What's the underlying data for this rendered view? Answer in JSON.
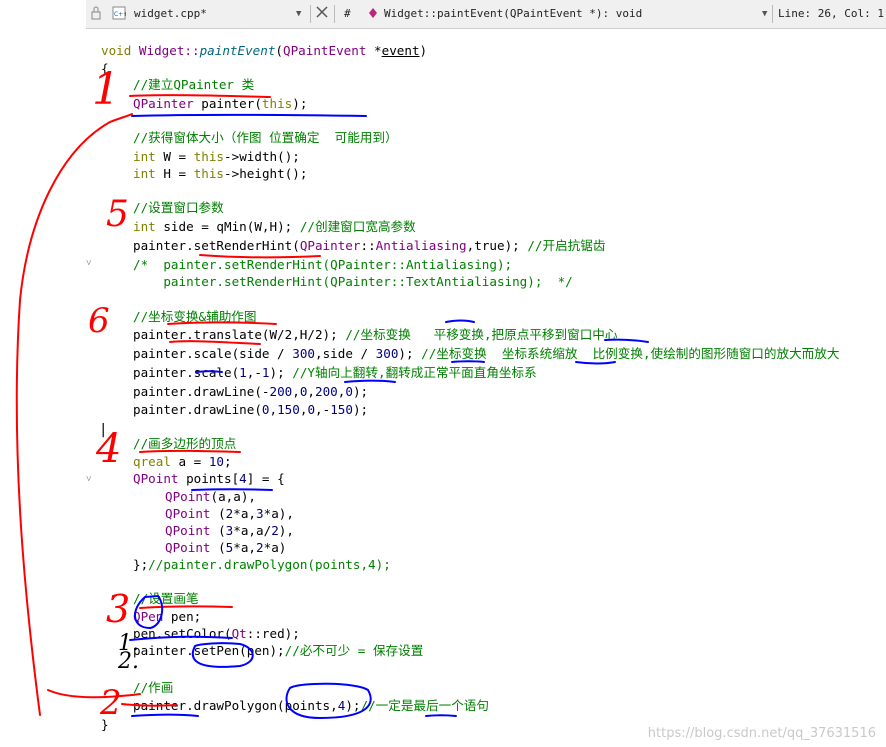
{
  "toolbar": {
    "filename": "widget.cpp*",
    "hash": "#",
    "function": "Widget::paintEvent(QPaintEvent *): void",
    "position": "Line: 26, Col: 1"
  },
  "code": {
    "l1": {
      "a": "void ",
      "b": "Widget::",
      "c": "paintEvent",
      "d": "(",
      "e": "QPaintEvent ",
      "f": "*",
      "g": "event",
      ")": ")"
    },
    "l2": "{",
    "l3": "//建立QPainter 类",
    "l4": {
      "a": "QPainter ",
      "b": "painter(",
      "c": "this",
      "d": ");"
    },
    "l5": "//获得窗体大小（作图 位置确定  可能用到）",
    "l6": {
      "a": "int ",
      "b": "W = ",
      "c": "this",
      "d": "->width();"
    },
    "l7": {
      "a": "int ",
      "b": "H = ",
      "c": "this",
      "d": "->height();"
    },
    "l8": "//设置窗口参数",
    "l9": {
      "a": "int ",
      "b": "side = qMin(W,H); ",
      "c": "//创建窗口宽高参数"
    },
    "l10": {
      "a": "painter.setRenderHint(",
      "b": "QPainter",
      "c": "::",
      "d": "Antialiasing",
      "e": ",true); ",
      "f": "//开启抗锯齿"
    },
    "l11": "/*  painter.setRenderHint(QPainter::Antialiasing);",
    "l12": "    painter.setRenderHint(QPainter::TextAntialiasing);  */",
    "l13": "//坐标变换&辅助作图",
    "l14": {
      "a": "painter.translate(W/2,H/2); ",
      "b": "//坐标变换   平移变换,把原点平移到窗口中心"
    },
    "l15": {
      "a": "painter.scale(side / ",
      "n1": "300",
      "b": ",side / ",
      "n2": "300",
      "c": "); ",
      "d": "//坐标变换  坐标系统缩放  比例变换,使绘制的图形随窗口的放大而放大"
    },
    "l16": {
      "a": "painter.scale(",
      "n1": "1",
      "b": ",-",
      "n2": "1",
      "c": "); ",
      "d": "//Y轴向上翻转,翻转成正常平面直角坐标系"
    },
    "l17": {
      "a": "painter.drawLine(-",
      "n1": "200",
      "b": ",",
      "n2": "0",
      "c": ",",
      "n3": "200",
      "d": ",",
      "n4": "0",
      "e": ");"
    },
    "l18": {
      "a": "painter.drawLine(",
      "n1": "0",
      "b": ",",
      "n2": "150",
      "c": ",",
      "n3": "0",
      "d": ",-",
      "n4": "150",
      "e": ");"
    },
    "l19": "//画多边形的顶点",
    "l20": {
      "a": "qreal ",
      "b": "a = ",
      "n1": "10",
      "c": ";"
    },
    "l21": {
      "a": "QPoint ",
      "b": "points[",
      "n1": "4",
      "c": "] = {"
    },
    "l22": {
      "a": "QPoint",
      "b": "(a,a),"
    },
    "l23": {
      "a": "QPoint",
      "b": " (",
      "n1": "2",
      "c": "*a,",
      "n2": "3",
      "d": "*a),"
    },
    "l24": {
      "a": "QPoint",
      "b": " (",
      "n1": "3",
      "c": "*a,a/",
      "n2": "2",
      "d": "),"
    },
    "l25": {
      "a": "QPoint",
      "b": " (",
      "n1": "5",
      "c": "*a,",
      "n2": "2",
      "d": "*a)"
    },
    "l26": {
      "a": "};",
      "b": "//painter.drawPolygon(points,4);"
    },
    "l27": "//设置画笔",
    "l28": {
      "a": "QPen ",
      "b": "pen;"
    },
    "l29": {
      "a": "pen.setColor(",
      "b": "Qt",
      "c": "::red);"
    },
    "l30": {
      "a": "painter.setPen(pen);",
      "b": "//必不可少 = 保存设置"
    },
    "l31": "//作画",
    "l32": {
      "a": "painter.drawPolygon(points,",
      "n1": "4",
      "b": ");",
      "c": "//一定是最后一个语句"
    },
    "l33": "}"
  },
  "annotations": {
    "n1": "1",
    "n5": "5",
    "n6": "6",
    "n4": "4",
    "n3": "3",
    "n2": "2",
    "sub1": "1.",
    "sub2": "2."
  },
  "watermark": "https://blog.csdn.net/qq_37631516",
  "colors": {
    "keyword": "#808000",
    "type": "#800080",
    "comment": "#008000",
    "number": "#000080",
    "red_ink": "#ff0000",
    "blue_ink": "#0000ff"
  }
}
